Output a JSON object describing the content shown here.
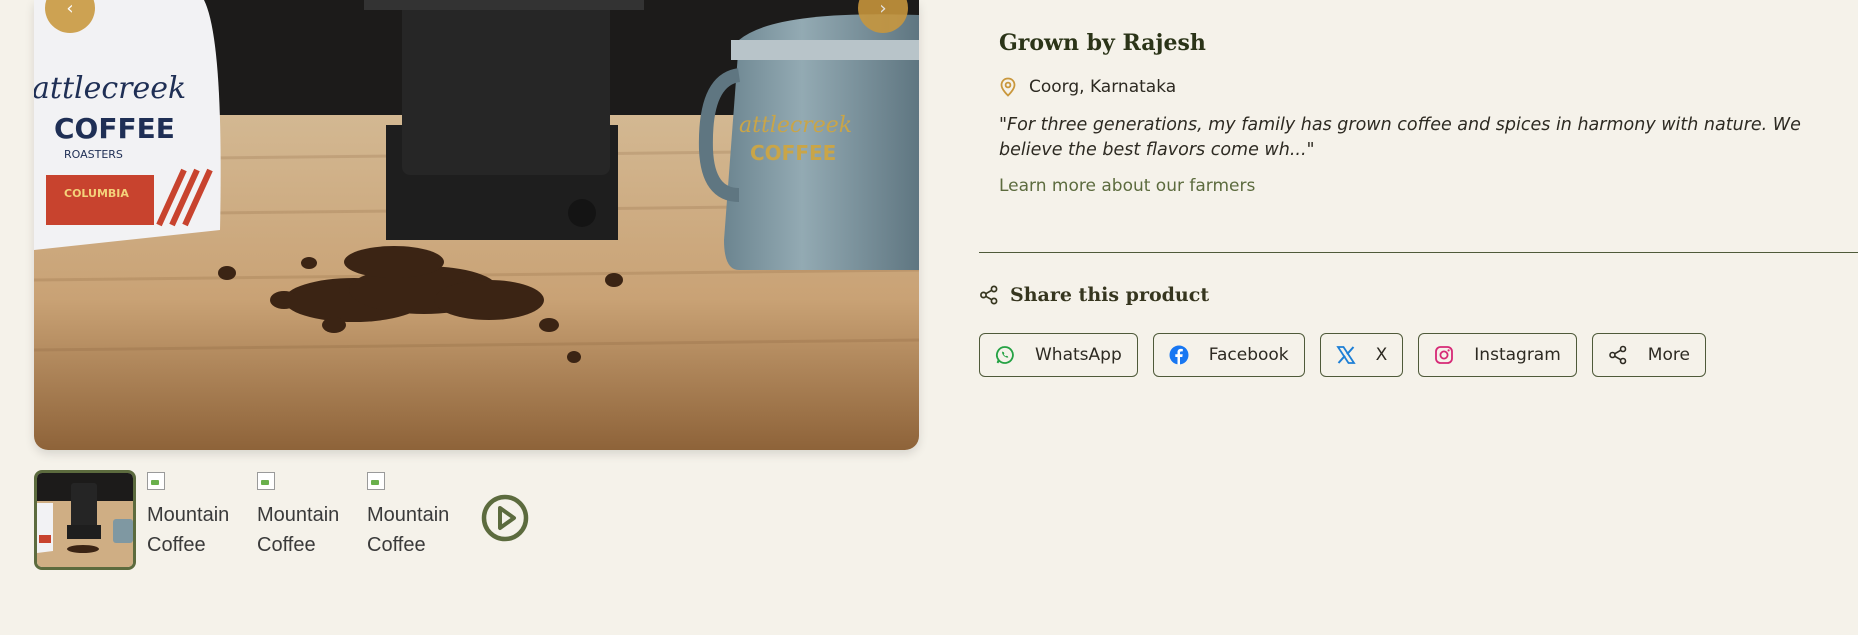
{
  "gallery": {
    "thumbnails": [
      {
        "alt": "Mountain Coffee Beans"
      },
      {
        "alt": "Mountain Coffee Beans"
      },
      {
        "alt": "Mountain Coffee Beans"
      }
    ],
    "prev_icon": "chevron-left-icon",
    "next_icon": "chevron-right-icon",
    "prev_label": "‹",
    "next_label": "›",
    "video_icon": "play-circle-icon"
  },
  "farmer": {
    "title": "Grown by Rajesh",
    "location": "Coorg, Karnataka",
    "quote": "\"For three generations, my family has grown coffee and spices in harmony with nature. We believe the best flavors come wh...\"",
    "link_label": "Learn more about our farmers"
  },
  "share": {
    "heading": "Share this product",
    "buttons": [
      {
        "label": "WhatsApp",
        "icon": "whatsapp-icon",
        "color": "#25a244"
      },
      {
        "label": "Facebook",
        "icon": "facebook-icon",
        "color": "#1877f2"
      },
      {
        "label": "X",
        "icon": "x-icon",
        "color": "#1da1f2"
      },
      {
        "label": "Instagram",
        "icon": "instagram-icon",
        "color": "#d62976"
      },
      {
        "label": "More",
        "icon": "share-icon",
        "color": "#2d2a22"
      }
    ]
  },
  "colors": {
    "background": "#f5f2ea",
    "accent_olive": "#5c6b3e",
    "accent_gold": "#c9973c"
  }
}
